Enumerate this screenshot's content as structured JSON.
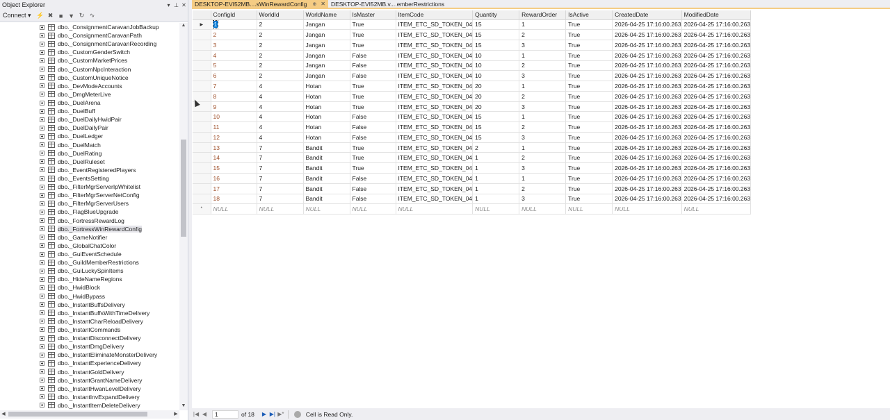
{
  "object_explorer": {
    "title": "Object Explorer",
    "window_buttons": [
      "▾",
      "⊥",
      "✕"
    ],
    "toolbar": {
      "connect_label": "Connect ▾",
      "icons": [
        "connect-icon",
        "disconnect-icon",
        "stop-icon",
        "filter-icon",
        "refresh-icon",
        "activity-monitor-icon"
      ]
    },
    "tree_items": [
      "dbo._ConsignmentCaravanJobBackup",
      "dbo._ConsignmentCaravanPath",
      "dbo._ConsignmentCaravanRecording",
      "dbo._CustomGenderSwitch",
      "dbo._CustomMarketPrices",
      "dbo._CustomNpcInteraction",
      "dbo._CustomUniqueNotice",
      "dbo._DevModeAccounts",
      "dbo._DmgMeterLive",
      "dbo._DuelArena",
      "dbo._DuelBuff",
      "dbo._DuelDailyHwidPair",
      "dbo._DuelDailyPair",
      "dbo._DuelLedger",
      "dbo._DuelMatch",
      "dbo._DuelRating",
      "dbo._DuelRuleset",
      "dbo._EventRegisteredPlayers",
      "dbo._EventsSetting",
      "dbo._FilterMgrServerIpWhitelist",
      "dbo._FilterMgrServerNetConfig",
      "dbo._FilterMgrServerUsers",
      "dbo._FlagBlueUpgrade",
      "dbo._FortressRewardLog",
      "dbo._FortressWinRewardConfig",
      "dbo._GameNotifier",
      "dbo._GlobalChatColor",
      "dbo._GuiEventSchedule",
      "dbo._GuildMemberRestrictions",
      "dbo._GuiLuckySpinItems",
      "dbo._HideNameRegions",
      "dbo._HwidBlock",
      "dbo._HwidBypass",
      "dbo._InstantBuffsDelivery",
      "dbo._InstantBuffsWithTimeDelivery",
      "dbo._InstantCharReloadDelivery",
      "dbo._InstantCommands",
      "dbo._InstantDisconnectDelivery",
      "dbo._InstantDmgDelivery",
      "dbo._InstantEliminateMonsterDelivery",
      "dbo._InstantExperienceDelivery",
      "dbo._InstantGoldDelivery",
      "dbo._InstantGrantNameDelivery",
      "dbo._InstantHwanLevelDelivery",
      "dbo._InstantInvExpandDelivery",
      "dbo._InstantItemDeleteDelivery"
    ],
    "selected_item": "dbo._FortressWinRewardConfig"
  },
  "tabs": [
    {
      "label": "DESKTOP-EVI52MB....sWinRewardConfig",
      "pin": "⊕",
      "close": "✕"
    },
    {
      "label": "DESKTOP-EVI52MB.v....emberRestrictions"
    }
  ],
  "grid": {
    "columns": [
      "ConfigId",
      "WorldId",
      "WorldName",
      "IsMaster",
      "ItemCode",
      "Quantity",
      "RewardOrder",
      "IsActive",
      "CreatedDate",
      "ModifiedDate"
    ],
    "rows": [
      [
        "1",
        "2",
        "Jangan",
        "True",
        "ITEM_ETC_SD_TOKEN_04",
        "15",
        "1",
        "True",
        "2026-04-25 17:16:00.263",
        "2026-04-25 17:16:00.263"
      ],
      [
        "2",
        "2",
        "Jangan",
        "True",
        "ITEM_ETC_SD_TOKEN_04",
        "15",
        "2",
        "True",
        "2026-04-25 17:16:00.263",
        "2026-04-25 17:16:00.263"
      ],
      [
        "3",
        "2",
        "Jangan",
        "True",
        "ITEM_ETC_SD_TOKEN_04",
        "15",
        "3",
        "True",
        "2026-04-25 17:16:00.263",
        "2026-04-25 17:16:00.263"
      ],
      [
        "4",
        "2",
        "Jangan",
        "False",
        "ITEM_ETC_SD_TOKEN_04",
        "10",
        "1",
        "True",
        "2026-04-25 17:16:00.263",
        "2026-04-25 17:16:00.263"
      ],
      [
        "5",
        "2",
        "Jangan",
        "False",
        "ITEM_ETC_SD_TOKEN_04",
        "10",
        "2",
        "True",
        "2026-04-25 17:16:00.263",
        "2026-04-25 17:16:00.263"
      ],
      [
        "6",
        "2",
        "Jangan",
        "False",
        "ITEM_ETC_SD_TOKEN_04",
        "10",
        "3",
        "True",
        "2026-04-25 17:16:00.263",
        "2026-04-25 17:16:00.263"
      ],
      [
        "7",
        "4",
        "Hotan",
        "True",
        "ITEM_ETC_SD_TOKEN_04",
        "20",
        "1",
        "True",
        "2026-04-25 17:16:00.263",
        "2026-04-25 17:16:00.263"
      ],
      [
        "8",
        "4",
        "Hotan",
        "True",
        "ITEM_ETC_SD_TOKEN_04",
        "20",
        "2",
        "True",
        "2026-04-25 17:16:00.263",
        "2026-04-25 17:16:00.263"
      ],
      [
        "9",
        "4",
        "Hotan",
        "True",
        "ITEM_ETC_SD_TOKEN_04",
        "20",
        "3",
        "True",
        "2026-04-25 17:16:00.263",
        "2026-04-25 17:16:00.263"
      ],
      [
        "10",
        "4",
        "Hotan",
        "False",
        "ITEM_ETC_SD_TOKEN_04",
        "15",
        "1",
        "True",
        "2026-04-25 17:16:00.263",
        "2026-04-25 17:16:00.263"
      ],
      [
        "11",
        "4",
        "Hotan",
        "False",
        "ITEM_ETC_SD_TOKEN_04",
        "15",
        "2",
        "True",
        "2026-04-25 17:16:00.263",
        "2026-04-25 17:16:00.263"
      ],
      [
        "12",
        "4",
        "Hotan",
        "False",
        "ITEM_ETC_SD_TOKEN_04",
        "15",
        "3",
        "True",
        "2026-04-25 17:16:00.263",
        "2026-04-25 17:16:00.263"
      ],
      [
        "13",
        "7",
        "Bandit",
        "True",
        "ITEM_ETC_SD_TOKEN_04",
        "2",
        "1",
        "True",
        "2026-04-25 17:16:00.263",
        "2026-04-25 17:16:00.263"
      ],
      [
        "14",
        "7",
        "Bandit",
        "True",
        "ITEM_ETC_SD_TOKEN_04",
        "1",
        "2",
        "True",
        "2026-04-25 17:16:00.263",
        "2026-04-25 17:16:00.263"
      ],
      [
        "15",
        "7",
        "Bandit",
        "True",
        "ITEM_ETC_SD_TOKEN_04",
        "1",
        "3",
        "True",
        "2026-04-25 17:16:00.263",
        "2026-04-25 17:16:00.263"
      ],
      [
        "16",
        "7",
        "Bandit",
        "False",
        "ITEM_ETC_SD_TOKEN_04",
        "1",
        "1",
        "True",
        "2026-04-25 17:16:00.263",
        "2026-04-25 17:16:00.263"
      ],
      [
        "17",
        "7",
        "Bandit",
        "False",
        "ITEM_ETC_SD_TOKEN_04",
        "1",
        "2",
        "True",
        "2026-04-25 17:16:00.263",
        "2026-04-25 17:16:00.263"
      ],
      [
        "18",
        "7",
        "Bandit",
        "False",
        "ITEM_ETC_SD_TOKEN_04",
        "1",
        "3",
        "True",
        "2026-04-25 17:16:00.263",
        "2026-04-25 17:16:00.263"
      ]
    ],
    "null_row": [
      "NULL",
      "NULL",
      "NULL",
      "NULL",
      "NULL",
      "NULL",
      "NULL",
      "NULL",
      "NULL",
      "NULL"
    ],
    "current_row_marker": "▶",
    "new_row_marker": "*"
  },
  "navigator": {
    "record_value": "1",
    "of_label": "of 18",
    "status": "Cell is Read Only."
  }
}
